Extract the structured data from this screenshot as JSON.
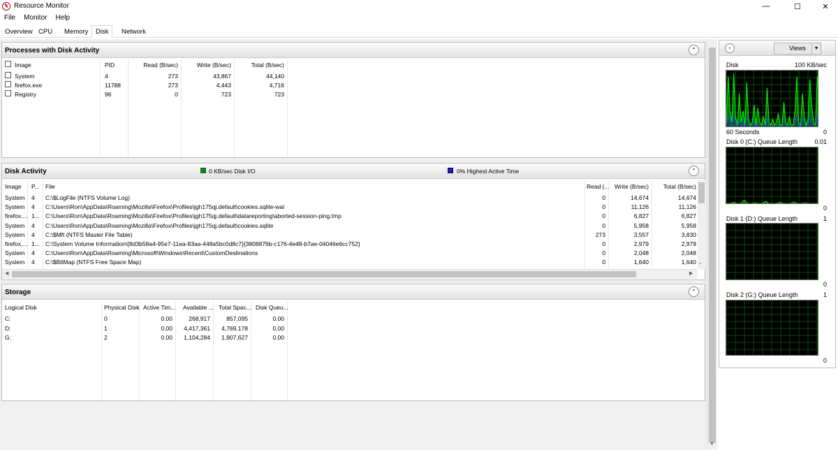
{
  "window": {
    "title": "Resource Monitor",
    "minimize": "—",
    "maximize": "☐",
    "close": "✕"
  },
  "menu": [
    "File",
    "Monitor",
    "Help"
  ],
  "tabs": [
    "Overview",
    "CPU",
    "Memory",
    "Disk",
    "Network"
  ],
  "active_tab": "Disk",
  "processes": {
    "title": "Processes with Disk Activity",
    "columns": [
      "Image",
      "PID",
      "Read (B/sec)",
      "Write (B/sec)",
      "Total (B/sec)"
    ],
    "rows": [
      [
        "System",
        "4",
        "273",
        "43,867",
        "44,140"
      ],
      [
        "firefox.exe",
        "11788",
        "273",
        "4,443",
        "4,716"
      ],
      [
        "Registry",
        "96",
        "0",
        "723",
        "723"
      ]
    ]
  },
  "disk_activity": {
    "title": "Disk Activity",
    "legend_io": "0 KB/sec Disk I/O",
    "legend_active": "0% Highest Active Time",
    "io_color": "#0c8a0c",
    "active_color": "#1d1dbd",
    "columns": [
      "Image",
      "P...",
      "File",
      "Read (...",
      "Write (B/sec)",
      "Total (B/sec)"
    ],
    "rows": [
      [
        "System",
        "4",
        "C:\\$LogFile (NTFS Volume Log)",
        "0",
        "14,674",
        "14,674"
      ],
      [
        "System",
        "4",
        "C:\\Users\\Ron\\AppData\\Roaming\\Mozilla\\Firefox\\Profiles\\jgh175qj.default\\cookies.sqlite-wal",
        "0",
        "11,126",
        "11,126"
      ],
      [
        "firefox....",
        "1...",
        "C:\\Users\\Ron\\AppData\\Roaming\\Mozilla\\Firefox\\Profiles\\jgh175qj.default\\datareporting\\aborted-session-ping.tmp",
        "0",
        "6,827",
        "6,827"
      ],
      [
        "System",
        "4",
        "C:\\Users\\Ron\\AppData\\Roaming\\Mozilla\\Firefox\\Profiles\\jgh175qj.default\\cookies.sqlite",
        "0",
        "5,958",
        "5,958"
      ],
      [
        "System",
        "4",
        "C:\\$Mft (NTFS Master File Table)",
        "273",
        "3,557",
        "3,830"
      ],
      [
        "firefox....",
        "1...",
        "C:\\System Volume Information\\{8d3b58a4-95e7-11ea-83aa-448a5bc0d8c7}{3808876b-c176-4e48-b7ae-04046e6cc752}",
        "0",
        "2,979",
        "2,979"
      ],
      [
        "System",
        "4",
        "C:\\Users\\Ron\\AppData\\Roaming\\Microsoft\\Windows\\Recent\\CustomDestinations",
        "0",
        "2,048",
        "2,048"
      ],
      [
        "System",
        "4",
        "C:\\$BitMap (NTFS Free Space Map)",
        "0",
        "1,640",
        "1,640"
      ]
    ]
  },
  "storage": {
    "title": "Storage",
    "columns": [
      "Logical Disk",
      "Physical Disk",
      "Active Tim...",
      "Available ...",
      "Total Spac...",
      "Disk Queu..."
    ],
    "rows": [
      [
        "C:",
        "0",
        "0.00",
        "268,917",
        "857,095",
        "0.00"
      ],
      [
        "D:",
        "1",
        "0.00",
        "4,417,361",
        "4,769,178",
        "0.00"
      ],
      [
        "G:",
        "2",
        "0.00",
        "1,104,284",
        "1,907,627",
        "0.00"
      ]
    ]
  },
  "side": {
    "views_label": "Views",
    "expand_icon": "chevron-right-icon",
    "graphs": [
      {
        "title": "Disk",
        "max": "100 KB/sec",
        "footer_left": "60 Seconds",
        "footer_right": "0"
      },
      {
        "title": "Disk 0 (C:) Queue Length",
        "max": "0.01",
        "footer_left": "",
        "footer_right": "0"
      },
      {
        "title": "Disk 1 (D:) Queue Length",
        "max": "1",
        "footer_left": "",
        "footer_right": "0"
      },
      {
        "title": "Disk 2 (G:) Queue Length",
        "max": "1",
        "footer_left": "",
        "footer_right": "0"
      }
    ]
  }
}
